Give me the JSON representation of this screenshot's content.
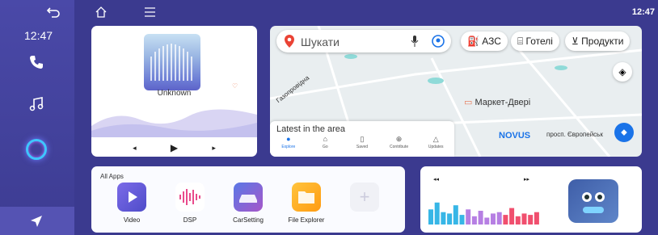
{
  "sidebar": {
    "time": "12:47"
  },
  "topbar": {
    "clock": "12:47"
  },
  "music": {
    "track": "Unknown"
  },
  "map": {
    "search_placeholder": "Шукати",
    "chips": [
      "АЗС",
      "Готелі",
      "Продукти"
    ],
    "street1": "Газопровідна",
    "street2": "просп. Європейськ",
    "poi1": "Маркет-Двері",
    "poi2": "NOVUS",
    "latest": "Latest in the area",
    "nav": [
      "Explore",
      "Go",
      "Saved",
      "Contribute",
      "Updates"
    ]
  },
  "apps": {
    "header": "All Apps",
    "items": [
      {
        "label": "Video",
        "color": "#6b5bd6"
      },
      {
        "label": "DSP",
        "color": "#e94b8c"
      },
      {
        "label": "CarSetting",
        "color": "#4e6ad8"
      },
      {
        "label": "File Explorer",
        "color": "#ffb020"
      }
    ]
  },
  "eq": {
    "levels": [
      0.55,
      0.8,
      0.45,
      0.4,
      0.7,
      0.35,
      0.55,
      0.3,
      0.5,
      0.25,
      0.4,
      0.45,
      0.35,
      0.6,
      0.3,
      0.4,
      0.35,
      0.45
    ]
  }
}
